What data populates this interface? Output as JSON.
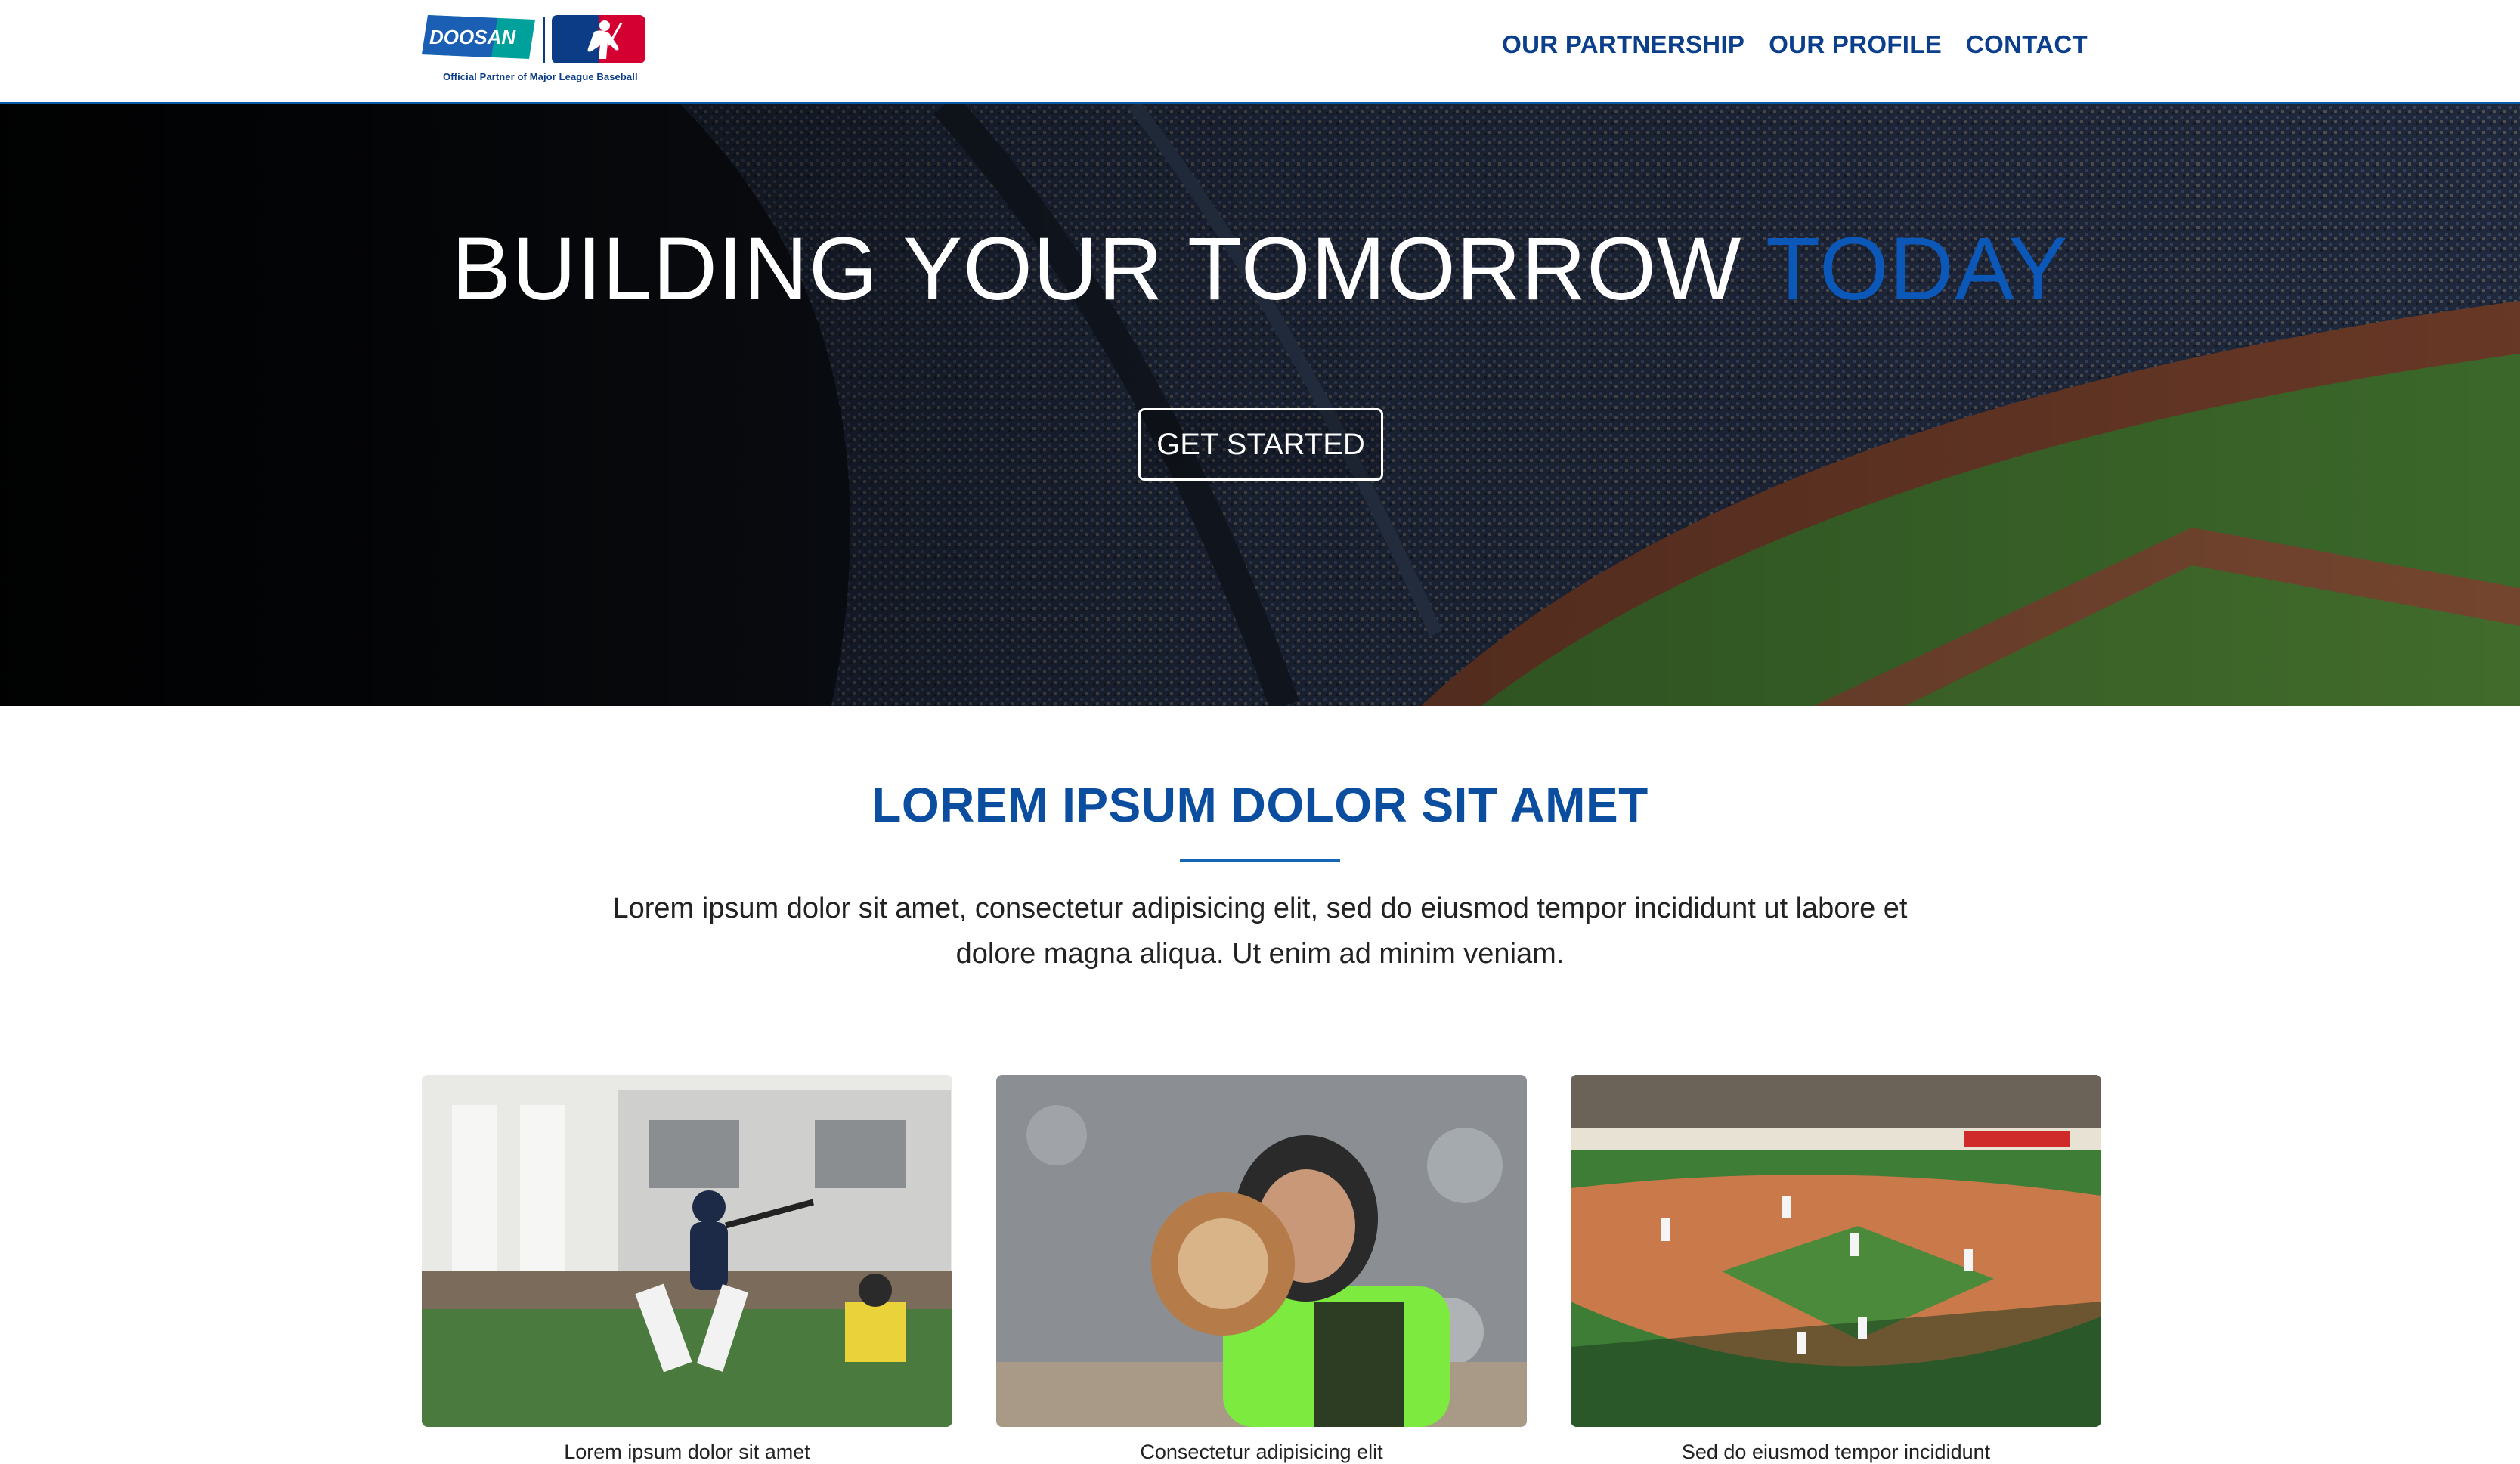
{
  "header": {
    "logo": {
      "brand": "DOOSAN",
      "tagline": "Official Partner of Major League Baseball"
    },
    "nav": [
      {
        "label": "OUR PARTNERSHIP"
      },
      {
        "label": "OUR PROFILE"
      },
      {
        "label": "CONTACT"
      }
    ]
  },
  "hero": {
    "title_main": "BUILDING YOUR TOMORROW ",
    "title_accent": "TODAY",
    "cta_label": "GET STARTED"
  },
  "intro": {
    "title": "LOREM IPSUM DOLOR SIT AMET",
    "body": "Lorem ipsum dolor sit amet, consectetur adipisicing elit, sed do eiusmod tempor incididunt ut labore et dolore magna aliqua. Ut enim ad minim veniam."
  },
  "cards": [
    {
      "caption": "Lorem ipsum dolor sit amet"
    },
    {
      "caption": "Consectetur adipisicing elit"
    },
    {
      "caption": "Sed do eiusmod tempor incididunt"
    }
  ],
  "colors": {
    "brand_blue": "#0b4ea0",
    "accent_blue": "#0c58b8",
    "nav_blue": "#0b3f8c",
    "doosan_blue": "#1b5fb5",
    "doosan_green": "#00a19a",
    "mlb_red": "#d50032"
  }
}
